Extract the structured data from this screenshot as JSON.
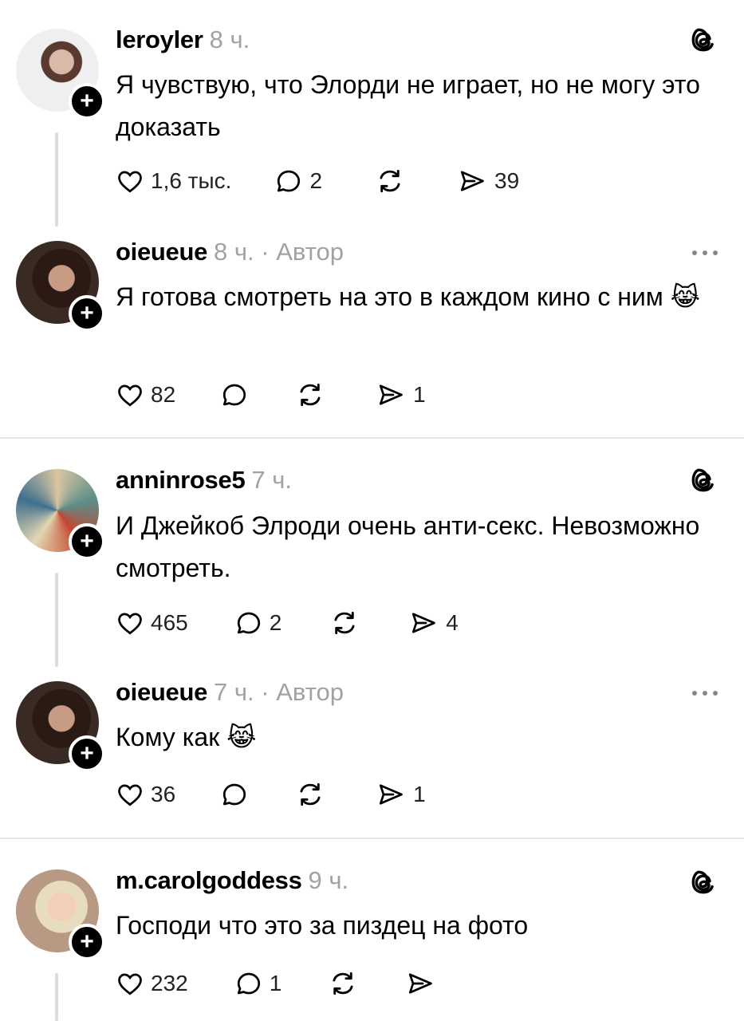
{
  "colors": {
    "text": "#000000",
    "muted": "#a2a2a2",
    "line": "#dcdcdc",
    "divider": "#e6e6e6"
  },
  "posts": [
    {
      "username": "leroyler",
      "time": "8 ч.",
      "author": "",
      "text": "Я чувствую, что Элорди не играет, но не могу это доказать",
      "likes": "1,6 тыс.",
      "replies": "2",
      "reposts": "",
      "shares": "39",
      "corner_icon": "threads-logo-icon"
    },
    {
      "username": "oieueue",
      "time": "8 ч.",
      "author": "· Автор",
      "text": "Я готова смотреть на это в каждом кино с ним 😹",
      "likes": "82",
      "replies": "",
      "reposts": "",
      "shares": "1",
      "corner_icon": "more-options-icon"
    },
    {
      "username": "anninrose5",
      "time": "7 ч.",
      "author": "",
      "text": "И Джейкоб Элроди очень анти-секс. Невозможно смотреть.",
      "likes": "465",
      "replies": "2",
      "reposts": "",
      "shares": "4",
      "corner_icon": "threads-logo-icon"
    },
    {
      "username": "oieueue",
      "time": "7 ч.",
      "author": "· Автор",
      "text": "Кому как 😹",
      "likes": "36",
      "replies": "",
      "reposts": "",
      "shares": "1",
      "corner_icon": "more-options-icon"
    },
    {
      "username": "m.carolgoddess",
      "time": "9 ч.",
      "author": "",
      "text": "Господи что это за пиздец на фото",
      "likes": "232",
      "replies": "1",
      "reposts": "",
      "shares": "",
      "corner_icon": "threads-logo-icon"
    }
  ]
}
